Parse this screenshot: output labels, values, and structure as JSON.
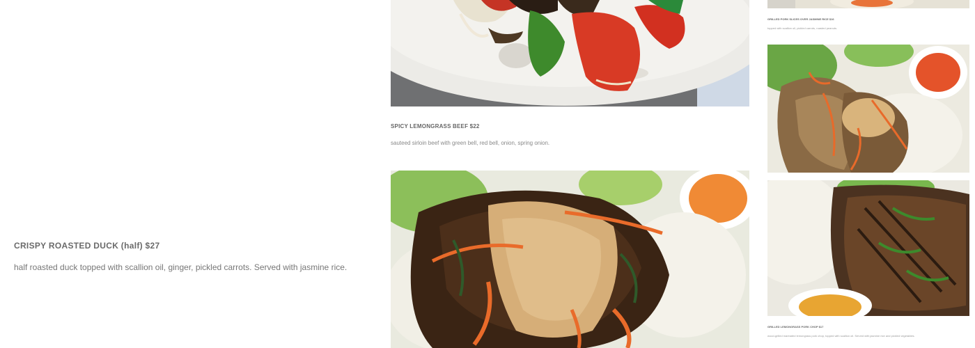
{
  "left_item": {
    "title": "CRISPY ROASTED DUCK (half) $27",
    "description": "half roasted duck topped with scallion oil, ginger, pickled carrots. Served with jasmine rice."
  },
  "middle_item": {
    "title": "SPICY LEMONGRASS BEEF $22",
    "description": "sauteed sirloin beef with green bell, red bell, onion, spring onion."
  },
  "right_items": [
    {
      "title": "GRILLED PORK SLICES OVER JASMINE RICE $16",
      "description": "topped with scallion oil, pickled carrots, roasted peanuts."
    },
    {
      "title": "GRILLED LEMONGRASS PORK CHOP $17",
      "description": "wood-grilled marinated lemongrass pork chop, topped with scallion oil. Served with jasmine rice and pickled vegetables."
    }
  ],
  "images": {
    "beef_stirfry": "food-photo-beef-stirfry",
    "beef_rice": "food-photo-beef-over-rice",
    "pork_slices": "food-photo-pork-slices",
    "pork_chop": "food-photo-pork-chop"
  },
  "colors": {
    "plate_white": "#f2f2f0",
    "pepper_red": "#d83a25",
    "pepper_green": "#3c8a2c",
    "rice": "#f4f2ea",
    "grilled_meat": "#5a3a22",
    "carrot": "#e86a2a",
    "peanut": "#d8b07a"
  }
}
